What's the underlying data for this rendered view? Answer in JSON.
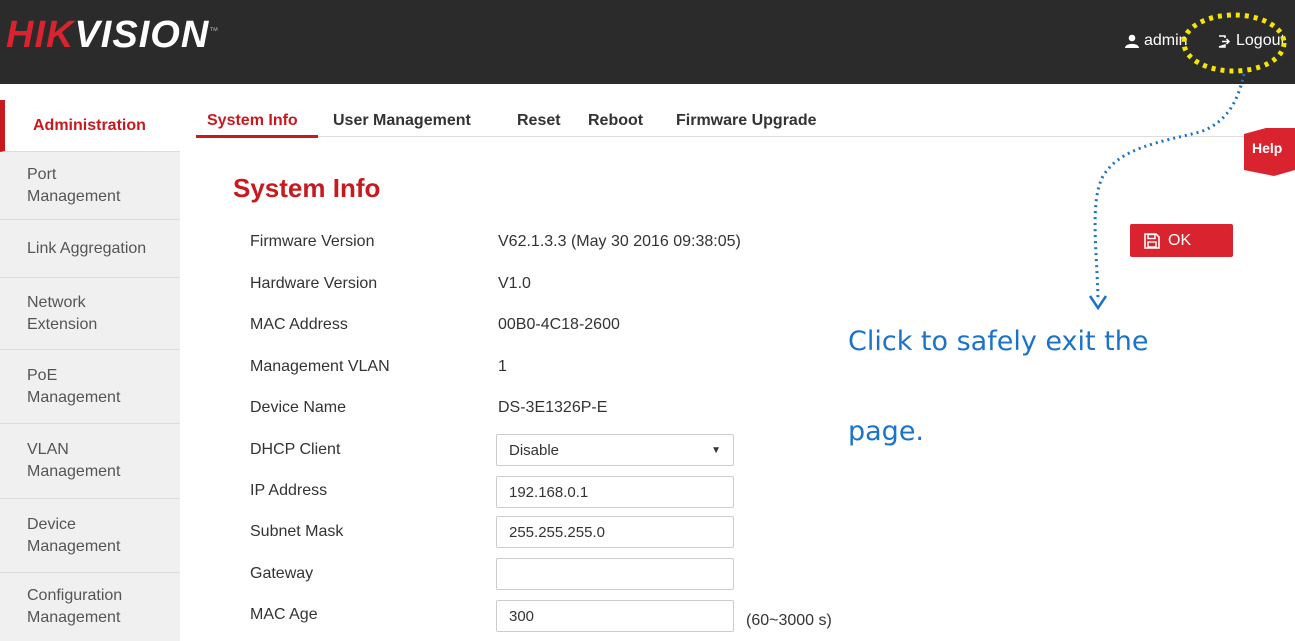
{
  "header": {
    "logo_hik": "HIK",
    "logo_vision": "VISION",
    "logo_tm": "™",
    "user": "admin",
    "logout": "Logout"
  },
  "sidebar": {
    "items": [
      {
        "line1": "Administration",
        "line2": ""
      },
      {
        "line1": "Port",
        "line2": "Management"
      },
      {
        "line1": "Link Aggregation",
        "line2": ""
      },
      {
        "line1": "Network",
        "line2": "Extension"
      },
      {
        "line1": "PoE",
        "line2": "Management"
      },
      {
        "line1": "VLAN",
        "line2": "Management"
      },
      {
        "line1": "Device",
        "line2": "Management"
      },
      {
        "line1": "Configuration",
        "line2": "Management"
      }
    ]
  },
  "tabs": [
    "System Info",
    "User Management",
    "Reset",
    "Reboot",
    "Firmware Upgrade"
  ],
  "help_label": "Help",
  "page_title": "System Info",
  "info": {
    "firmware_label": "Firmware Version",
    "firmware_value": "V62.1.3.3 (May 30 2016 09:38:05)",
    "hardware_label": "Hardware Version",
    "hardware_value": "V1.0",
    "mac_label": "MAC Address",
    "mac_value": "00B0-4C18-2600",
    "vlan_label": "Management VLAN",
    "vlan_value": "1",
    "device_label": "Device Name",
    "device_value": "DS-3E1326P-E"
  },
  "form": {
    "dhcp_label": "DHCP Client",
    "dhcp_value": "Disable",
    "ip_label": "IP Address",
    "ip_value": "192.168.0.1",
    "subnet_label": "Subnet Mask",
    "subnet_value": "255.255.255.0",
    "gateway_label": "Gateway",
    "gateway_value": "",
    "macage_label": "MAC Age",
    "macage_value": "300",
    "macage_hint": "(60~3000 s)"
  },
  "ok_button": "OK",
  "annotation": {
    "line1": "Click to safely exit the",
    "line2": "page."
  },
  "colors": {
    "brand_red": "#d9232e",
    "annotation_blue": "#1a73c9",
    "highlight_yellow": "#f5e600"
  }
}
